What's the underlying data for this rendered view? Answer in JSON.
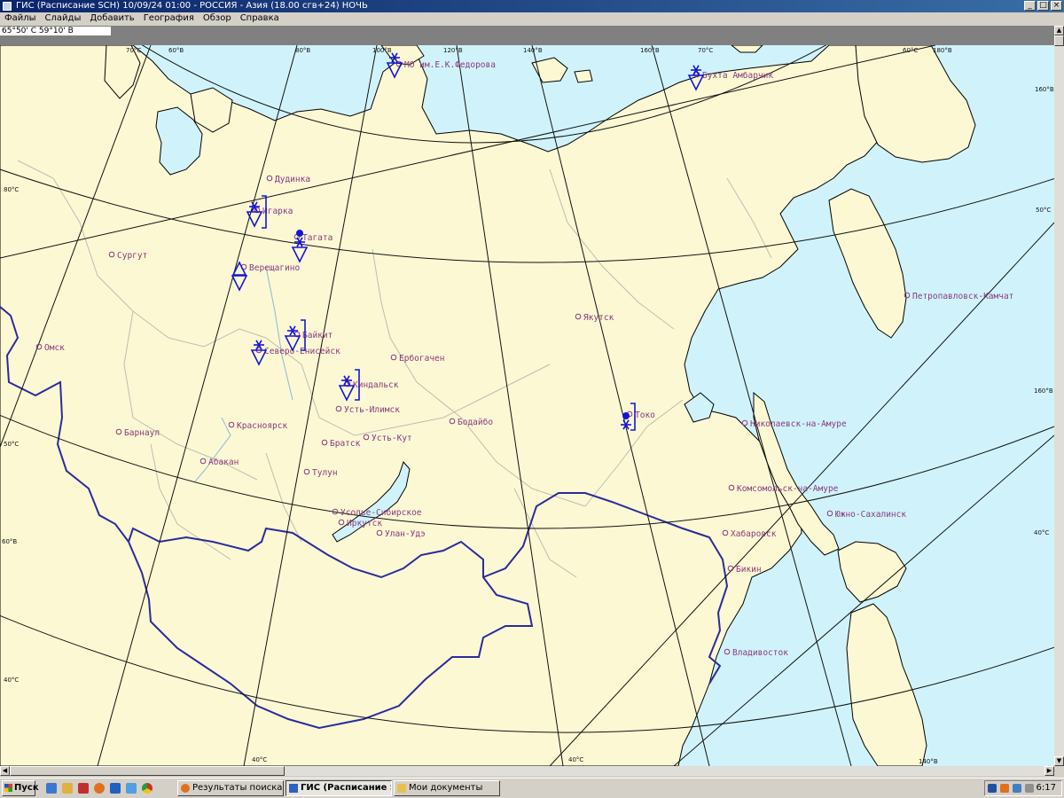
{
  "window": {
    "title": "ГИС (Расписание SCH) 10/09/24 01:00 - РОССИЯ - Азия (18.00 сгв+24) НОЧЬ",
    "controls": {
      "minimize": "_",
      "maximize": "□",
      "close": "×"
    }
  },
  "menu": [
    "Файлы",
    "Слайды",
    "Добавить",
    "География",
    "Обзор",
    "Справка"
  ],
  "coords": {
    "value": "65°50' С 59°10' В"
  },
  "map": {
    "colors": {
      "land": "#fcf8d4",
      "sea": "#d0f3fb",
      "coast": "#000000",
      "border": "#2b2b9a",
      "grid": "#111111",
      "city_label": "#8a3a80",
      "symbol": "#1515d8"
    },
    "grid_labels": {
      "top": [
        "70°С",
        "60°В",
        "80°В",
        "100°В",
        "120°В",
        "140°В",
        "160°В",
        "70°С",
        "60°С",
        "180°В"
      ],
      "left": [
        "80°С",
        "50°С",
        "60°В",
        "40°С"
      ],
      "right": [
        "160°В",
        "50°С",
        "160°В",
        "40°С"
      ],
      "bottom": [
        "40°С",
        "40°С",
        "140°В"
      ]
    },
    "cities": [
      "Дудинка",
      "Игарка",
      "Тагата",
      "Сургут",
      "Верещагино",
      "Якутск",
      "Петропавловск-Камчат",
      "Омск",
      "Байкит",
      "Северо-Енисейск",
      "Ербогачен",
      "Киндальск",
      "Усть-Илимск",
      "Бодайбо",
      "Токо",
      "Николаевск-на-Амуре",
      "Барнаул",
      "Красноярск",
      "Братск",
      "Усть-Кут",
      "Абакан",
      "Тулун",
      "Комсомольск-на-Амуре",
      "Усолье-Сибирское",
      "Иркутск",
      "Улан-Удэ",
      "Хабаровск",
      "Южно-Сахалинск",
      "Бикин",
      "Владивосток",
      "МО им.Е.К.Федорова",
      "Бухта Амбарчик"
    ]
  },
  "taskbar": {
    "start": "Пуск",
    "tasks": [
      "Результаты поиска - е...",
      "ГИС (Расписание SCH...",
      "Мои документы"
    ],
    "clock": "6:17"
  }
}
